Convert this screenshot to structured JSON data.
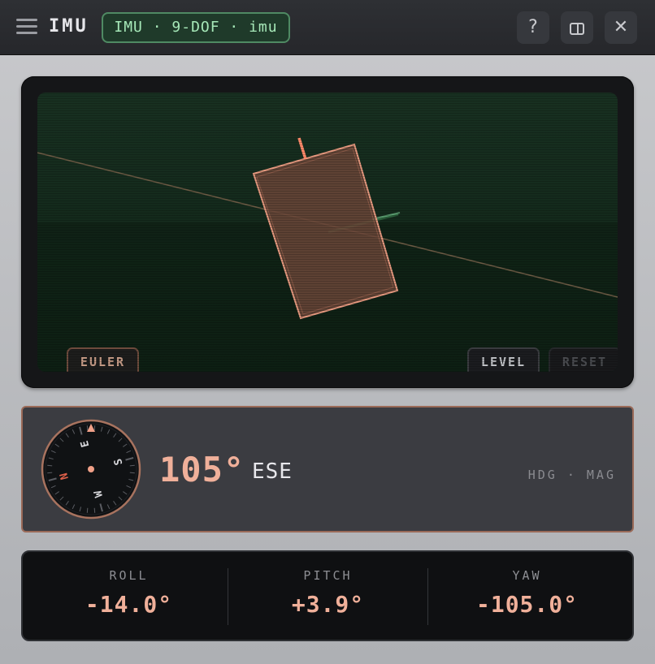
{
  "titlebar": {
    "title": "IMU",
    "device_chip": "IMU · 9-DOF · imu",
    "help_label": "?",
    "close_label": "✕"
  },
  "viewport": {
    "euler_button": "EULER",
    "level_button": "LEVEL",
    "reset_button": "RESET"
  },
  "heading": {
    "value": "105°",
    "cardinal": "ESE",
    "caption": "HDG · MAG",
    "compass_letters": {
      "n": "N",
      "e": "E",
      "s": "S",
      "w": "W"
    }
  },
  "euler": [
    {
      "label": "ROLL",
      "value": "-14.0°"
    },
    {
      "label": "PITCH",
      "value": "+3.9°"
    },
    {
      "label": "YAW",
      "value": "-105.0°"
    }
  ],
  "colors": {
    "accent": "#f0b09a",
    "chip_green": "#a6e8b8",
    "panel_border": "#9a6a58"
  }
}
